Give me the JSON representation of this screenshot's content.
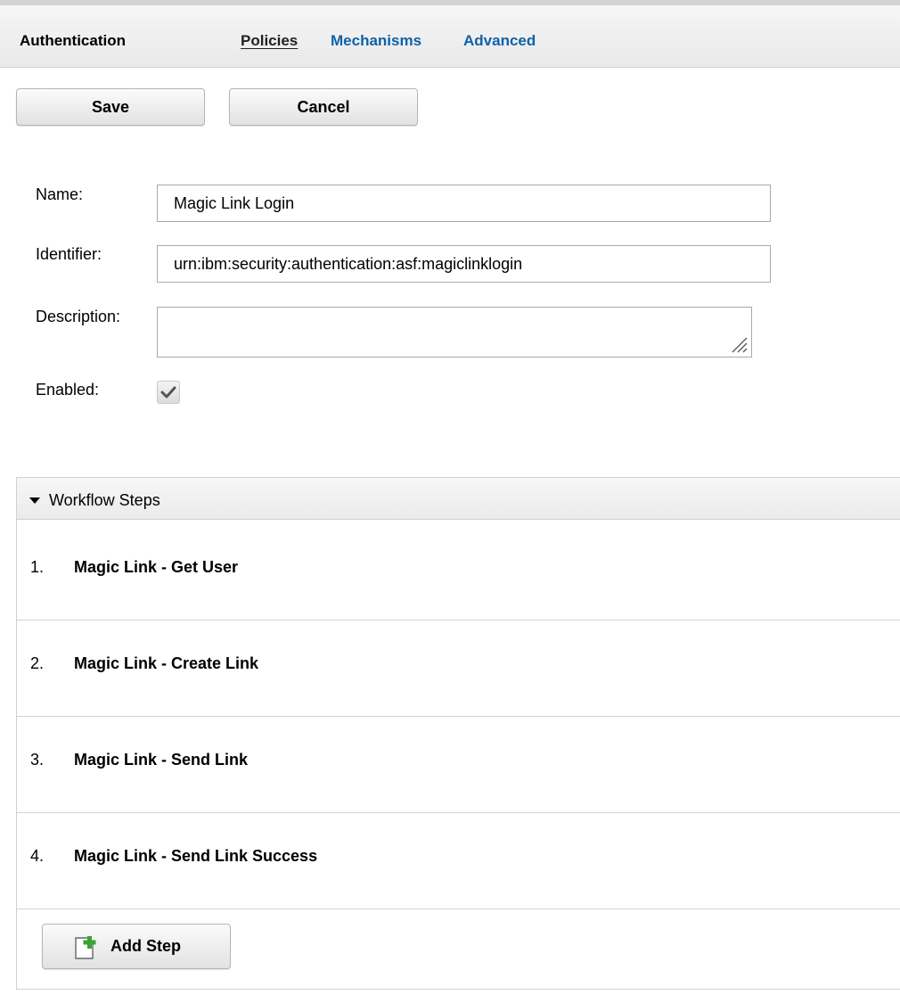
{
  "header": {
    "title": "Authentication",
    "tabs": [
      {
        "label": "Policies",
        "active": true
      },
      {
        "label": "Mechanisms",
        "active": false
      },
      {
        "label": "Advanced",
        "active": false
      }
    ]
  },
  "toolbar": {
    "save_label": "Save",
    "cancel_label": "Cancel"
  },
  "form": {
    "name_label": "Name:",
    "name_value": "Magic Link Login",
    "identifier_label": "Identifier:",
    "identifier_value": "urn:ibm:security:authentication:asf:magiclinklogin",
    "description_label": "Description:",
    "description_value": "",
    "enabled_label": "Enabled:",
    "enabled": true
  },
  "workflow": {
    "title": "Workflow Steps",
    "steps": [
      {
        "number": "1.",
        "name": "Magic Link - Get User"
      },
      {
        "number": "2.",
        "name": "Magic Link - Create Link"
      },
      {
        "number": "3.",
        "name": "Magic Link - Send Link"
      },
      {
        "number": "4.",
        "name": "Magic Link - Send Link Success"
      }
    ],
    "add_step_label": "Add Step"
  },
  "colors": {
    "link_blue": "#0f62a8",
    "add_icon_green": "#3aa334"
  },
  "icons": {
    "expand": "caret-down-icon",
    "add_step": "add-document-icon",
    "checkbox": "checkmark-icon",
    "resize": "resize-grip-icon"
  }
}
